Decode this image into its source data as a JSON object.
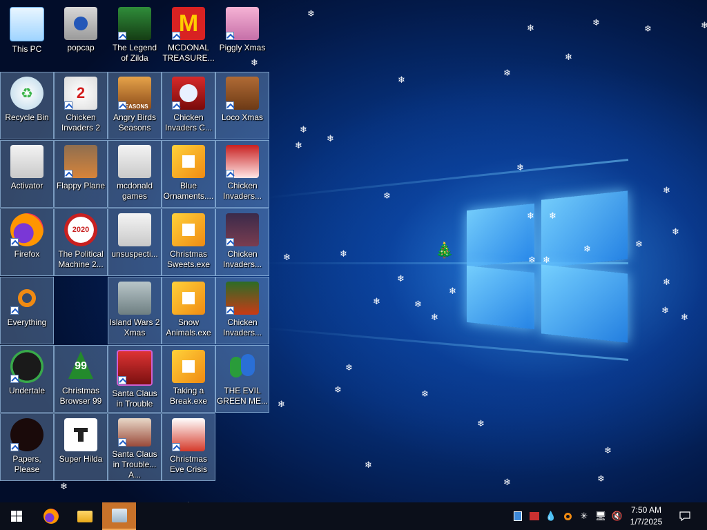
{
  "desktop": {
    "icons": [
      {
        "label": "This PC"
      },
      {
        "label": "popcap"
      },
      {
        "label": "The Legend of Zilda"
      },
      {
        "label": "MCDONAL TREASURE..."
      },
      {
        "label": "Piggly Xmas"
      },
      {
        "label": "Recycle Bin"
      },
      {
        "label": "Chicken Invaders 2",
        "badge": "2"
      },
      {
        "label": "Angry Birds Seasons",
        "badge": "SEASONS"
      },
      {
        "label": "Chicken Invaders C..."
      },
      {
        "label": "Loco Xmas"
      },
      {
        "label": "Activator"
      },
      {
        "label": "Flappy Plane"
      },
      {
        "label": "mcdonald games"
      },
      {
        "label": "Blue Ornaments...."
      },
      {
        "label": "Chicken Invaders..."
      },
      {
        "label": "Firefox"
      },
      {
        "label": "The Political Machine 2...",
        "badge": "2020"
      },
      {
        "label": "unsuspecti..."
      },
      {
        "label": "Christmas Sweets.exe"
      },
      {
        "label": "Chicken Invaders..."
      },
      {
        "label": "Everything"
      },
      {
        "label": "Island Wars 2 Xmas"
      },
      {
        "label": "Snow Animals.exe"
      },
      {
        "label": "Chicken Invaders..."
      },
      {
        "label": "Undertale"
      },
      {
        "label": "Christmas Browser 99",
        "badge": "99"
      },
      {
        "label": "Santa Claus in Trouble"
      },
      {
        "label": "Taking a Break.exe"
      },
      {
        "label": "THE EVIL GREEN ME..."
      },
      {
        "label": "Papers, Please"
      },
      {
        "label": "Super Hilda"
      },
      {
        "label": "Santa Claus in Trouble... A..."
      },
      {
        "label": "Christmas Eve Crisis"
      }
    ]
  },
  "taskbar": {
    "start": "windows-logo-icon",
    "pinned": [
      "firefox-icon",
      "file-explorer-icon",
      "app-icon"
    ],
    "tray": [
      "network-icon",
      "app-tray-icon",
      "droplet-icon",
      "search-tray-icon",
      "sparkle-icon",
      "network-wired-icon",
      "volume-muted-icon"
    ],
    "clock": {
      "time": "7:50 AM",
      "date": "1/7/2025"
    },
    "notifications_icon": "notification-icon"
  },
  "colors": {
    "accent": "#0a63d6",
    "taskbar": "#0b0f1a",
    "selection": "#9bc3eb"
  }
}
